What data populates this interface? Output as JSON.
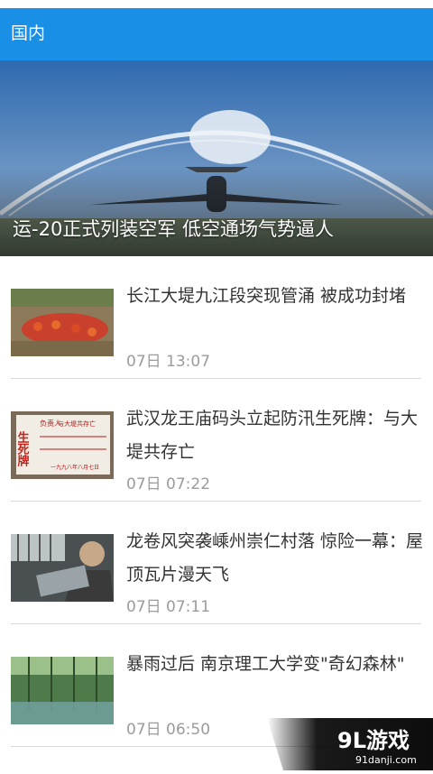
{
  "header": {
    "title": "国内"
  },
  "hero": {
    "caption": "运-20正式列装空军 低空通场气势逼人"
  },
  "news": [
    {
      "title": "长江大堤九江段突现管涌 被成功封堵",
      "time": "07日 13:07"
    },
    {
      "title": "武汉龙王庙码头立起防汛生死牌：与大堤共存亡",
      "time": "07日 07:22"
    },
    {
      "title": "龙卷风突袭嵊州崇仁村落 惊险一幕：屋顶瓦片漫天飞",
      "time": "07日 07:11"
    },
    {
      "title": "暴雨过后 南京理工大学变\"奇幻森林\"",
      "time": "07日 06:50"
    }
  ],
  "thumb_texts": {
    "sign_big": "生死牌",
    "sign_l1": "负责人",
    "sign_l2": "与大堤共存亡",
    "sign_bottom": "一九九八年八月七日"
  },
  "watermark": {
    "logo": "9L游戏",
    "url": "91danji.com"
  },
  "colors": {
    "header": "#1a8fe6",
    "time": "#9b9b9b",
    "divider": "#cfdce8"
  }
}
